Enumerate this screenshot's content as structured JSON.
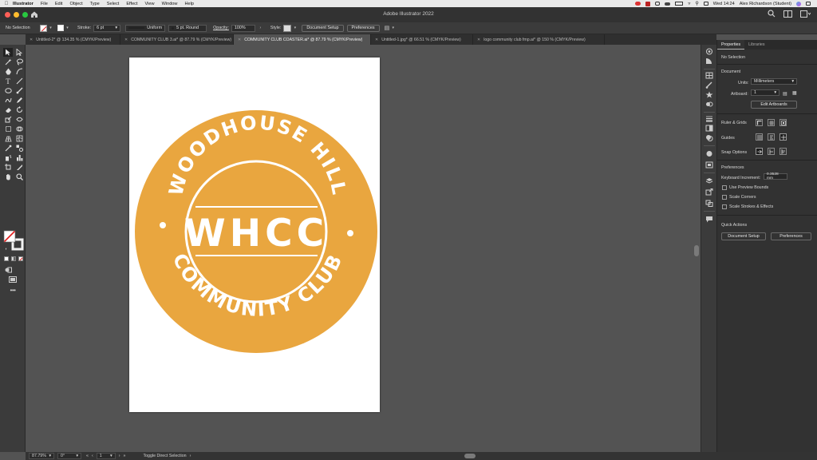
{
  "menubar": {
    "app_name": "Illustrator",
    "items": [
      "File",
      "Edit",
      "Object",
      "Type",
      "Select",
      "Effect",
      "View",
      "Window",
      "Help"
    ],
    "clock": "Wed 14:24",
    "user": "Alex Richardson (Student)"
  },
  "window": {
    "title": "Adobe Illustrator 2022"
  },
  "control": {
    "selection": "No Selection",
    "stroke_label": "Stroke:",
    "stroke_weight": "6 pt",
    "profile": "Uniform",
    "brush": "5 pt. Round",
    "opacity_label": "Opacity:",
    "opacity": "100%",
    "style_label": "Style:",
    "document_setup": "Document Setup",
    "preferences": "Preferences"
  },
  "tabs": [
    {
      "label": "Untitled-2* @ 134.35 % (CMYK/Preview)",
      "active": false
    },
    {
      "label": "COMMUNITY CLUB 3.ai* @ 87.79 % (CMYK/Preview)",
      "active": false
    },
    {
      "label": "COMMUNITY CLUB COASTER.ai* @ 87.79 % (CMYK/Preview)",
      "active": true
    },
    {
      "label": "Untitled-1.jpg* @ 66.51 % (CMYK/Preview)",
      "active": false
    },
    {
      "label": "logo community club fmp.ai* @ 150 % (CMYK/Preview)",
      "active": false
    }
  ],
  "artwork": {
    "top_arc": "WOODHOUSE HILL",
    "bottom_arc": "COMMUNITY CLUB",
    "center": "WHCC",
    "badge_color": "#e9a63f",
    "text_color": "#ffffff"
  },
  "panel": {
    "tab_properties": "Properties",
    "tab_libraries": "Libraries",
    "selection": "No Selection",
    "document_heading": "Document",
    "units_label": "Units:",
    "units_value": "Millimeters",
    "artboard_label": "Artboard:",
    "artboard_value": "1",
    "edit_artboards": "Edit Artboards",
    "ruler_grids": "Ruler & Grids",
    "guides": "Guides",
    "snap_options": "Snap Options",
    "preferences_heading": "Preferences",
    "keyboard_increment_label": "Keyboard Increment:",
    "keyboard_increment_value": "0.3528 mm",
    "use_preview_bounds": "Use Preview Bounds",
    "scale_corners": "Scale Corners",
    "scale_strokes": "Scale Strokes & Effects",
    "quick_actions": "Quick Actions",
    "document_setup": "Document Setup",
    "preferences": "Preferences"
  },
  "status": {
    "zoom": "87.79%",
    "rotation": "0°",
    "artboard": "1",
    "tool": "Toggle Direct Selection"
  }
}
